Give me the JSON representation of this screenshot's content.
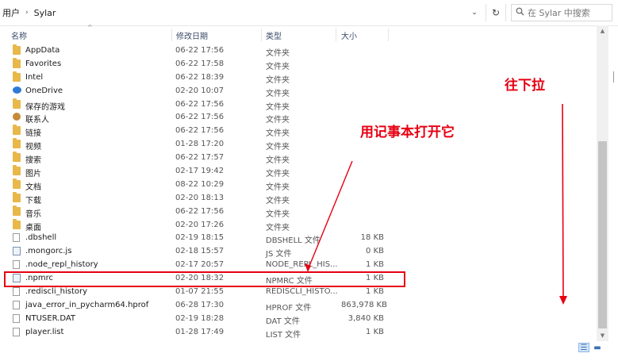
{
  "address": {
    "crumbs": [
      "用户",
      "Sylar"
    ],
    "separator": "›",
    "dropdown_glyph": "⌄",
    "refresh_glyph": "↻"
  },
  "search": {
    "placeholder": "在 Sylar 中搜索"
  },
  "columns": {
    "name": "名称",
    "date": "修改日期",
    "type": "类型",
    "size": "大小"
  },
  "files": [
    {
      "name": "AppData",
      "date": "06-22 17:56",
      "type": "文件夹",
      "size": "",
      "icon": "folder-icon"
    },
    {
      "name": "Favorites",
      "date": "06-22 17:58",
      "type": "文件夹",
      "size": "",
      "icon": "folder-icon"
    },
    {
      "name": "Intel",
      "date": "06-22 18:39",
      "type": "文件夹",
      "size": "",
      "icon": "folder-icon"
    },
    {
      "name": "OneDrive",
      "date": "02-20 10:07",
      "type": "文件夹",
      "size": "",
      "icon": "onedrive-icon"
    },
    {
      "name": "保存的游戏",
      "date": "06-22 17:56",
      "type": "文件夹",
      "size": "",
      "icon": "saved-games-icon"
    },
    {
      "name": "联系人",
      "date": "06-22 17:56",
      "type": "文件夹",
      "size": "",
      "icon": "contacts-icon"
    },
    {
      "name": "链接",
      "date": "06-22 17:56",
      "type": "文件夹",
      "size": "",
      "icon": "links-icon"
    },
    {
      "name": "视频",
      "date": "01-28 17:20",
      "type": "文件夹",
      "size": "",
      "icon": "videos-icon"
    },
    {
      "name": "搜索",
      "date": "06-22 17:57",
      "type": "文件夹",
      "size": "",
      "icon": "searches-icon"
    },
    {
      "name": "图片",
      "date": "02-17 19:42",
      "type": "文件夹",
      "size": "",
      "icon": "pictures-icon"
    },
    {
      "name": "文档",
      "date": "08-22 10:29",
      "type": "文件夹",
      "size": "",
      "icon": "documents-icon"
    },
    {
      "name": "下载",
      "date": "02-20 18:13",
      "type": "文件夹",
      "size": "",
      "icon": "downloads-icon"
    },
    {
      "name": "音乐",
      "date": "06-22 17:56",
      "type": "文件夹",
      "size": "",
      "icon": "music-icon"
    },
    {
      "name": "桌面",
      "date": "02-20 17:26",
      "type": "文件夹",
      "size": "",
      "icon": "desktop-icon"
    },
    {
      "name": ".dbshell",
      "date": "02-19 18:15",
      "type": "DBSHELL 文件",
      "size": "18 KB",
      "icon": "file-icon"
    },
    {
      "name": ".mongorc.js",
      "date": "02-18 15:57",
      "type": "JS 文件",
      "size": "0 KB",
      "icon": "script-file-icon"
    },
    {
      "name": ".node_repl_history",
      "date": "02-17 20:57",
      "type": "NODE_REPL_HIS...",
      "size": "1 KB",
      "icon": "file-icon"
    },
    {
      "name": ".npmrc",
      "date": "02-20 18:32",
      "type": "NPMRC 文件",
      "size": "1 KB",
      "icon": "script-file-icon"
    },
    {
      "name": ".rediscli_history",
      "date": "01-07 21:55",
      "type": "REDISCLI_HISTO...",
      "size": "1 KB",
      "icon": "file-icon"
    },
    {
      "name": "java_error_in_pycharm64.hprof",
      "date": "06-28 17:30",
      "type": "HPROF 文件",
      "size": "863,978 KB",
      "icon": "file-icon"
    },
    {
      "name": "NTUSER.DAT",
      "date": "02-19 18:28",
      "type": "DAT 文件",
      "size": "3,840 KB",
      "icon": "file-icon"
    },
    {
      "name": "player.list",
      "date": "01-28 17:49",
      "type": "LIST 文件",
      "size": "1 KB",
      "icon": "file-icon"
    }
  ],
  "annotations": {
    "open_with_notepad": "用记事本打开它",
    "scroll_down": "往下拉",
    "color": "#e60012"
  }
}
